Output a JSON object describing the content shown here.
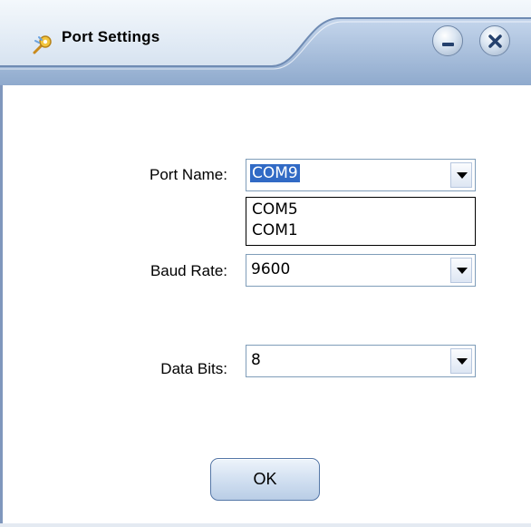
{
  "window": {
    "title": "Port Settings"
  },
  "form": {
    "port_name": {
      "label": "Port Name:",
      "selected": "COM9",
      "options_visible": [
        "COM5",
        "COM1"
      ]
    },
    "baud_rate": {
      "label": "Baud Rate:",
      "selected": "9600"
    },
    "data_bits": {
      "label": "Data Bits:",
      "selected": "8"
    }
  },
  "buttons": {
    "ok_label": "OK"
  },
  "icons": {
    "app": "settings-app-icon",
    "minimize": "minimize-icon",
    "close": "close-icon",
    "dropdown": "chevron-down-icon"
  },
  "colors": {
    "selection": "#316ac5",
    "frame": "#7f97bd",
    "titlebar_wave": "#9eb7d8"
  }
}
